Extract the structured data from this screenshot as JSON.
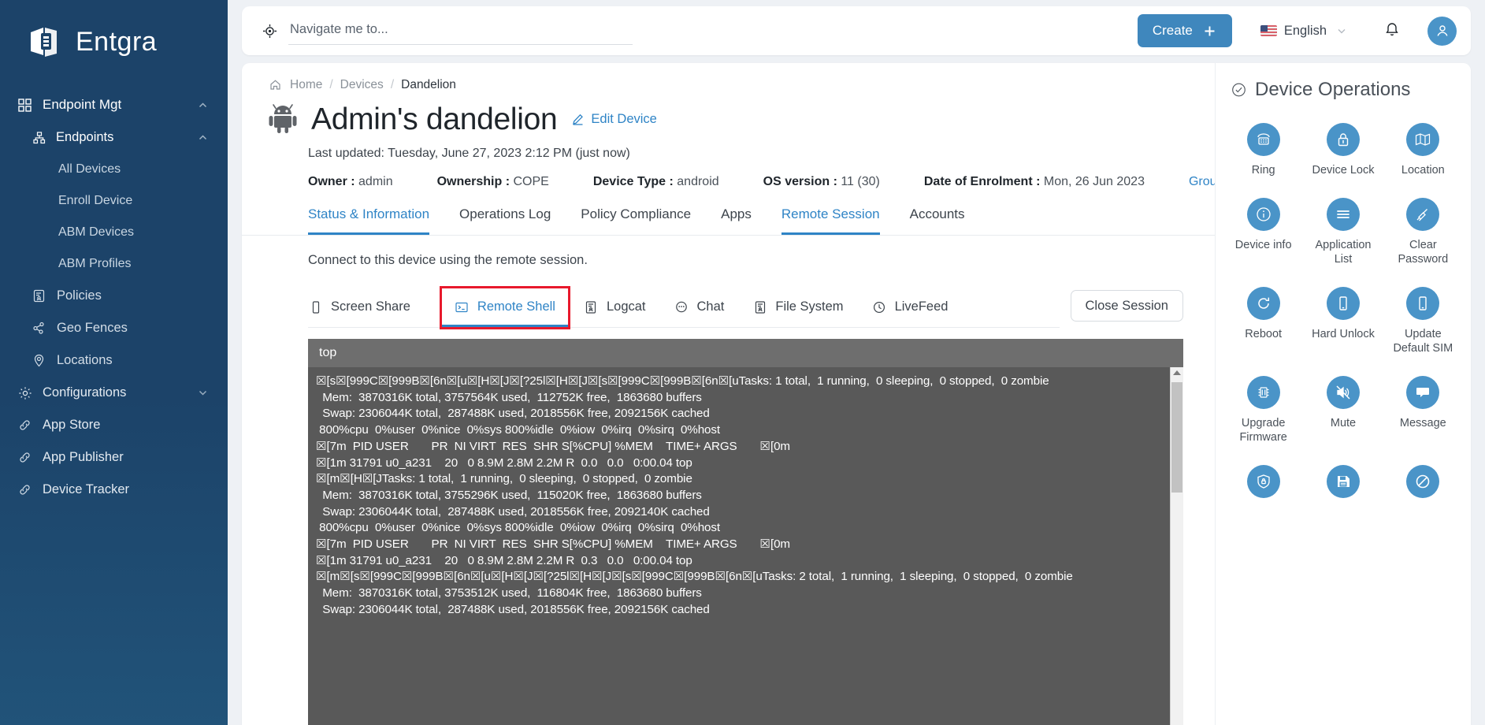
{
  "brand": {
    "name": "Entgra",
    "logo_icon": "entgra-cube-logo"
  },
  "sidebar": {
    "group": {
      "label": "Endpoint Mgt",
      "icon": "grid-icon",
      "chevron": "chevron-up-icon"
    },
    "subgroup": {
      "label": "Endpoints",
      "icon": "sitemap-icon",
      "chevron": "chevron-up-icon"
    },
    "leaves": [
      {
        "label": "All Devices"
      },
      {
        "label": "Enroll Device"
      },
      {
        "label": "ABM Devices"
      },
      {
        "label": "ABM Profiles"
      }
    ],
    "items": [
      {
        "label": "Policies",
        "icon": "policy-icon"
      },
      {
        "label": "Geo Fences",
        "icon": "geofence-icon"
      },
      {
        "label": "Locations",
        "icon": "location-pin-icon"
      }
    ],
    "configurations": {
      "label": "Configurations",
      "icon": "gear-icon",
      "chevron": "chevron-down-icon"
    },
    "roots": [
      {
        "label": "App Store",
        "icon": "link-icon"
      },
      {
        "label": "App Publisher",
        "icon": "link-icon"
      },
      {
        "label": "Device Tracker",
        "icon": "link-icon"
      }
    ]
  },
  "topbar": {
    "search_placeholder": "Navigate me to...",
    "search_value": "",
    "search_icon": "navigate-target-icon",
    "create_label": "Create",
    "create_icon": "plus-icon",
    "language": "English",
    "language_chevron": "chevron-down-icon",
    "flag_icon": "us-flag-icon",
    "bell_icon": "bell-icon",
    "avatar_icon": "user-avatar-icon"
  },
  "breadcrumb": {
    "home": "Home",
    "devices": "Devices",
    "current": "Dandelion",
    "home_icon": "home-icon",
    "separator": "/"
  },
  "device": {
    "icon": "android-robot-icon",
    "title": "Admin's dandelion",
    "edit_label": "Edit Device",
    "edit_icon": "pencil-icon",
    "last_updated": "Last updated: Tuesday, June 27, 2023 2:12 PM (just now)",
    "meta": [
      {
        "label": "Owner :",
        "value": "admin"
      },
      {
        "label": "Ownership :",
        "value": "COPE"
      },
      {
        "label": "Device Type :",
        "value": "android"
      },
      {
        "label": "OS version :",
        "value": "11 (30)"
      },
      {
        "label": "Date of Enrolment :",
        "value": "Mon, 26 Jun 2023"
      }
    ],
    "groups_link": "Groups"
  },
  "tabs": [
    {
      "label": "Status & Information",
      "active": true
    },
    {
      "label": "Operations Log",
      "active": false
    },
    {
      "label": "Policy Compliance",
      "active": false
    },
    {
      "label": "Apps",
      "active": false
    },
    {
      "label": "Remote Session",
      "active": true
    },
    {
      "label": "Accounts",
      "active": false
    }
  ],
  "session": {
    "hint": "Connect to this device using the remote session.",
    "close_label": "Close Session",
    "subtabs": [
      {
        "label": "Screen Share",
        "icon": "phone-screen-icon",
        "active": false,
        "highlighted": false
      },
      {
        "label": "Remote Shell",
        "icon": "terminal-prompt-icon",
        "active": true,
        "highlighted": true
      },
      {
        "label": "Logcat",
        "icon": "logcat-icon",
        "active": false,
        "highlighted": false
      },
      {
        "label": "Chat",
        "icon": "chat-bubble-icon",
        "active": false,
        "highlighted": false
      },
      {
        "label": "File System",
        "icon": "file-system-icon",
        "active": false,
        "highlighted": false
      },
      {
        "label": "LiveFeed",
        "icon": "livefeed-icon",
        "active": false,
        "highlighted": false
      }
    ]
  },
  "terminal": {
    "command": "top",
    "lines": [
      "☒[s☒[999C☒[999B☒[6n☒[u☒[H☒[J☒[?25l☒[H☒[J☒[s☒[999C☒[999B☒[6n☒[uTasks: 1 total,  1 running,  0 sleeping,  0 stopped,  0 zombie",
      "  Mem:  3870316K total, 3757564K used,  112752K free,  1863680 buffers",
      "  Swap: 2306044K total,  287488K used, 2018556K free, 2092156K cached",
      " 800%cpu  0%user  0%nice  0%sys 800%idle  0%iow  0%irq  0%sirq  0%host",
      "☒[7m  PID USER       PR  NI VIRT  RES  SHR S[%CPU] %MEM    TIME+ ARGS       ☒[0m",
      "☒[1m 31791 u0_a231    20   0 8.9M 2.8M 2.2M R  0.0   0.0   0:00.04 top",
      "☒[m☒[H☒[JTasks: 1 total,  1 running,  0 sleeping,  0 stopped,  0 zombie",
      "  Mem:  3870316K total, 3755296K used,  115020K free,  1863680 buffers",
      "  Swap: 2306044K total,  287488K used, 2018556K free, 2092140K cached",
      " 800%cpu  0%user  0%nice  0%sys 800%idle  0%iow  0%irq  0%sirq  0%host",
      "☒[7m  PID USER       PR  NI VIRT  RES  SHR S[%CPU] %MEM    TIME+ ARGS       ☒[0m",
      "☒[1m 31791 u0_a231    20   0 8.9M 2.8M 2.2M R  0.3   0.0   0:00.04 top",
      "☒[m☒[s☒[999C☒[999B☒[6n☒[u☒[H☒[J☒[?25l☒[H☒[J☒[s☒[999C☒[999B☒[6n☒[uTasks: 2 total,  1 running,  1 sleeping,  0 stopped,  0 zombie",
      "  Mem:  3870316K total, 3753512K used,  116804K free,  1863680 buffers",
      "  Swap: 2306044K total,  287488K used, 2018556K free, 2092156K cached"
    ]
  },
  "operations": {
    "title": "Device Operations",
    "title_icon": "check-circle-icon",
    "items": [
      {
        "label": "Ring",
        "icon": "ring-phone-icon"
      },
      {
        "label": "Device Lock",
        "icon": "lock-icon"
      },
      {
        "label": "Location",
        "icon": "map-icon"
      },
      {
        "label": "Device info",
        "icon": "info-icon"
      },
      {
        "label": "Application List",
        "icon": "list-icon"
      },
      {
        "label": "Clear Password",
        "icon": "broom-icon"
      },
      {
        "label": "Reboot",
        "icon": "reboot-icon"
      },
      {
        "label": "Hard Unlock",
        "icon": "phone-icon"
      },
      {
        "label": "Update Default SIM",
        "icon": "sim-phone-icon"
      },
      {
        "label": "Upgrade Firmware",
        "icon": "chip-icon"
      },
      {
        "label": "Mute",
        "icon": "mute-icon"
      },
      {
        "label": "Message",
        "icon": "message-icon"
      },
      {
        "label": "",
        "icon": "shield-lock-icon"
      },
      {
        "label": "",
        "icon": "save-disk-icon"
      },
      {
        "label": "",
        "icon": "prohibit-icon"
      }
    ]
  },
  "colors": {
    "sidebar_bg": "#1c4369",
    "accent_blue": "#2f84c6",
    "button_blue": "#3f87bd",
    "op_circle": "#4a94c8",
    "highlight_red": "#e8192c",
    "terminal_bg": "#595959",
    "terminal_head_bg": "#6e6e6e"
  }
}
